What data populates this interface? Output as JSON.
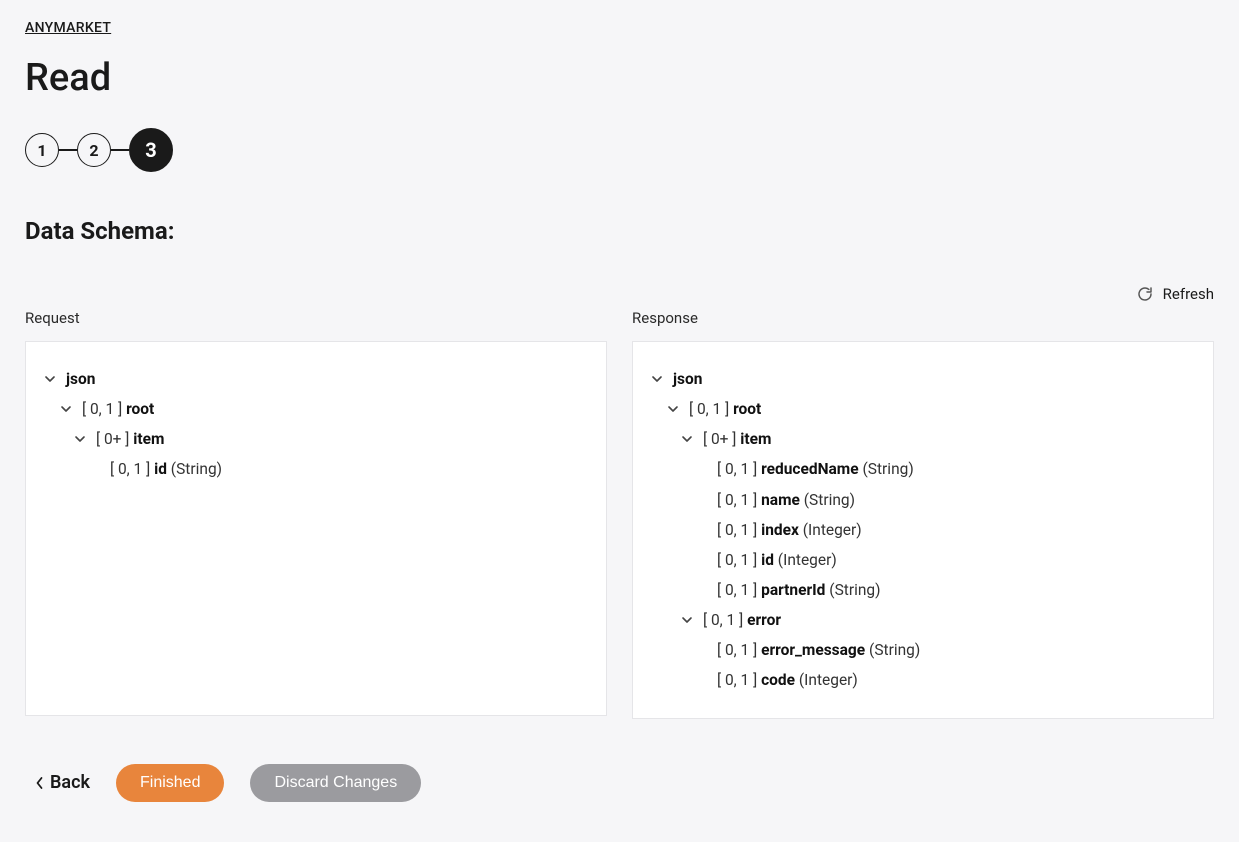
{
  "breadcrumb": "ANYMARKET",
  "title": "Read",
  "steps": [
    "1",
    "2",
    "3"
  ],
  "active_step_index": 2,
  "section_heading": "Data Schema:",
  "refresh_label": "Refresh",
  "request_label": "Request",
  "response_label": "Response",
  "request_tree": {
    "root_label": "json",
    "rows": [
      {
        "indent": 0,
        "chev": true,
        "card": "",
        "name": "json",
        "type": ""
      },
      {
        "indent": 1,
        "chev": true,
        "card": "[ 0, 1 ]",
        "name": "root",
        "type": ""
      },
      {
        "indent": 2,
        "chev": true,
        "card": "[ 0+ ]",
        "name": "item",
        "type": ""
      },
      {
        "indent": 3,
        "chev": false,
        "card": "[ 0, 1 ]",
        "name": "id",
        "type": "(String)"
      }
    ]
  },
  "response_tree": {
    "rows": [
      {
        "indent": 0,
        "chev": true,
        "card": "",
        "name": "json",
        "type": ""
      },
      {
        "indent": 1,
        "chev": true,
        "card": "[ 0, 1 ]",
        "name": "root",
        "type": ""
      },
      {
        "indent": 2,
        "chev": true,
        "card": "[ 0+ ]",
        "name": "item",
        "type": ""
      },
      {
        "indent": 3,
        "chev": false,
        "card": "[ 0, 1 ]",
        "name": "reducedName",
        "type": "(String)"
      },
      {
        "indent": 3,
        "chev": false,
        "card": "[ 0, 1 ]",
        "name": "name",
        "type": "(String)"
      },
      {
        "indent": 3,
        "chev": false,
        "card": "[ 0, 1 ]",
        "name": "index",
        "type": "(Integer)"
      },
      {
        "indent": 3,
        "chev": false,
        "card": "[ 0, 1 ]",
        "name": "id",
        "type": "(Integer)"
      },
      {
        "indent": 3,
        "chev": false,
        "card": "[ 0, 1 ]",
        "name": "partnerId",
        "type": "(String)"
      },
      {
        "indent": 2,
        "chev": true,
        "card": "[ 0, 1 ]",
        "name": "error",
        "type": ""
      },
      {
        "indent": 3,
        "chev": false,
        "card": "[ 0, 1 ]",
        "name": "error_message",
        "type": "(String)"
      },
      {
        "indent": 3,
        "chev": false,
        "card": "[ 0, 1 ]",
        "name": "code",
        "type": "(Integer)"
      }
    ]
  },
  "footer": {
    "back": "Back",
    "finished": "Finished",
    "discard": "Discard Changes"
  }
}
